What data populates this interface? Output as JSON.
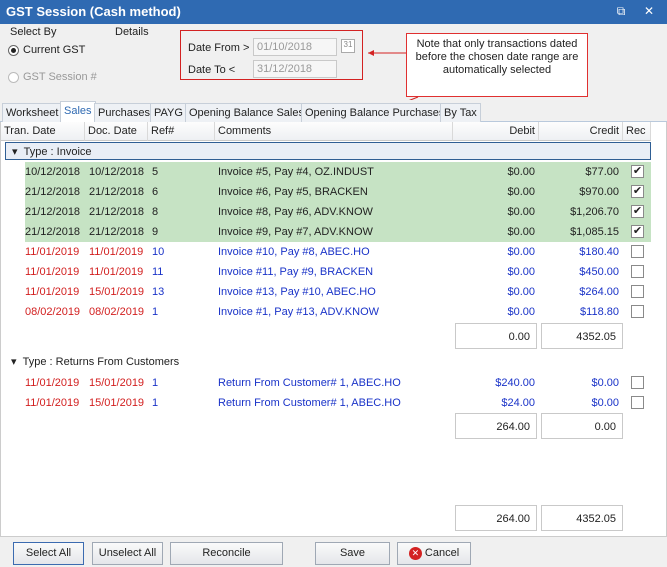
{
  "window": {
    "title": "GST Session (Cash method)",
    "restore_icon": "restore-icon",
    "close_icon": "close-icon"
  },
  "select_by": {
    "label": "Select By",
    "options": [
      {
        "label": "Current GST",
        "selected": true,
        "enabled": true
      },
      {
        "label": "GST Session #",
        "selected": false,
        "enabled": false
      }
    ]
  },
  "details": {
    "label": "Details",
    "date_from_label": "Date From >",
    "date_from": "01/10/2018",
    "date_to_label": "Date To <",
    "date_to": "31/12/2018",
    "calendar_icon": "calendar-icon",
    "calendar_glyph": "31"
  },
  "annotation": {
    "note": "Note that only transactions dated before the chosen date range are automatically selected"
  },
  "tabs": [
    {
      "label": "Worksheet",
      "active": false
    },
    {
      "label": "Sales",
      "active": true
    },
    {
      "label": "Purchases",
      "active": false
    },
    {
      "label": "PAYG",
      "active": false
    },
    {
      "label": "Opening Balance Sales",
      "active": false
    },
    {
      "label": "Opening Balance Purchases",
      "active": false
    },
    {
      "label": "By Tax",
      "active": false
    }
  ],
  "columns": [
    "Tran. Date",
    "Doc. Date",
    "Ref#",
    "Comments",
    "Debit",
    "Credit",
    "Rec"
  ],
  "groups": [
    {
      "label": "Type : Invoice",
      "rows": [
        {
          "tran_date": "10/12/2018",
          "doc_date": "10/12/2018",
          "ref": "5",
          "comments": "Invoice #5, Pay #4, OZ.INDUST",
          "debit": "$0.00",
          "credit": "$77.00",
          "rec": true
        },
        {
          "tran_date": "21/12/2018",
          "doc_date": "21/12/2018",
          "ref": "6",
          "comments": "Invoice #6, Pay #5, BRACKEN",
          "debit": "$0.00",
          "credit": "$970.00",
          "rec": true
        },
        {
          "tran_date": "21/12/2018",
          "doc_date": "21/12/2018",
          "ref": "8",
          "comments": "Invoice #8, Pay #6, ADV.KNOW",
          "debit": "$0.00",
          "credit": "$1,206.70",
          "rec": true
        },
        {
          "tran_date": "21/12/2018",
          "doc_date": "21/12/2018",
          "ref": "9",
          "comments": "Invoice #9, Pay #7, ADV.KNOW",
          "debit": "$0.00",
          "credit": "$1,085.15",
          "rec": true
        },
        {
          "tran_date": "11/01/2019",
          "doc_date": "11/01/2019",
          "ref": "10",
          "comments": "Invoice #10, Pay #8, ABEC.HO",
          "debit": "$0.00",
          "credit": "$180.40",
          "rec": false
        },
        {
          "tran_date": "11/01/2019",
          "doc_date": "11/01/2019",
          "ref": "11",
          "comments": "Invoice #11, Pay #9, BRACKEN",
          "debit": "$0.00",
          "credit": "$450.00",
          "rec": false
        },
        {
          "tran_date": "11/01/2019",
          "doc_date": "15/01/2019",
          "ref": "13",
          "comments": "Invoice #13, Pay #10, ABEC.HO",
          "debit": "$0.00",
          "credit": "$264.00",
          "rec": false
        },
        {
          "tran_date": "08/02/2019",
          "doc_date": "08/02/2019",
          "ref": "1",
          "comments": "Invoice #1, Pay #13, ADV.KNOW",
          "debit": "$0.00",
          "credit": "$118.80",
          "rec": false
        }
      ],
      "total_debit": "0.00",
      "total_credit": "4352.05"
    },
    {
      "label": "Type : Returns From Customers",
      "rows": [
        {
          "tran_date": "11/01/2019",
          "doc_date": "15/01/2019",
          "ref": "1",
          "comments": "Return From Customer# 1, ABEC.HO",
          "debit": "$240.00",
          "credit": "$0.00",
          "rec": false
        },
        {
          "tran_date": "11/01/2019",
          "doc_date": "15/01/2019",
          "ref": "1",
          "comments": "Return From Customer# 1, ABEC.HO",
          "debit": "$24.00",
          "credit": "$0.00",
          "rec": false
        }
      ],
      "total_debit": "264.00",
      "total_credit": "0.00"
    }
  ],
  "grand_total": {
    "debit": "264.00",
    "credit": "4352.05"
  },
  "buttons": {
    "select_all": "Select All",
    "unselect_all": "Unselect All",
    "reconcile": "Reconcile",
    "save": "Save",
    "cancel": "Cancel",
    "cancel_icon": "cancel-icon"
  },
  "colors": {
    "title_bar": "#2f6ab2",
    "selected_row": "#c6e3c4",
    "future_date": "#d21f1f",
    "unselected_text": "#1a33c8",
    "annotation": "#d32222"
  }
}
